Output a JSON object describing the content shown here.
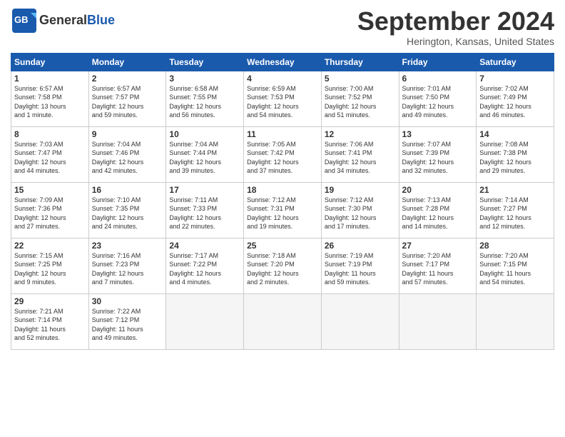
{
  "header": {
    "logo_general": "General",
    "logo_blue": "Blue",
    "title": "September 2024",
    "location": "Herington, Kansas, United States"
  },
  "calendar": {
    "days_of_week": [
      "Sunday",
      "Monday",
      "Tuesday",
      "Wednesday",
      "Thursday",
      "Friday",
      "Saturday"
    ],
    "weeks": [
      [
        {
          "day": "1",
          "info": "Sunrise: 6:57 AM\nSunset: 7:58 PM\nDaylight: 13 hours\nand 1 minute."
        },
        {
          "day": "2",
          "info": "Sunrise: 6:57 AM\nSunset: 7:57 PM\nDaylight: 12 hours\nand 59 minutes."
        },
        {
          "day": "3",
          "info": "Sunrise: 6:58 AM\nSunset: 7:55 PM\nDaylight: 12 hours\nand 56 minutes."
        },
        {
          "day": "4",
          "info": "Sunrise: 6:59 AM\nSunset: 7:53 PM\nDaylight: 12 hours\nand 54 minutes."
        },
        {
          "day": "5",
          "info": "Sunrise: 7:00 AM\nSunset: 7:52 PM\nDaylight: 12 hours\nand 51 minutes."
        },
        {
          "day": "6",
          "info": "Sunrise: 7:01 AM\nSunset: 7:50 PM\nDaylight: 12 hours\nand 49 minutes."
        },
        {
          "day": "7",
          "info": "Sunrise: 7:02 AM\nSunset: 7:49 PM\nDaylight: 12 hours\nand 46 minutes."
        }
      ],
      [
        {
          "day": "8",
          "info": "Sunrise: 7:03 AM\nSunset: 7:47 PM\nDaylight: 12 hours\nand 44 minutes."
        },
        {
          "day": "9",
          "info": "Sunrise: 7:04 AM\nSunset: 7:46 PM\nDaylight: 12 hours\nand 42 minutes."
        },
        {
          "day": "10",
          "info": "Sunrise: 7:04 AM\nSunset: 7:44 PM\nDaylight: 12 hours\nand 39 minutes."
        },
        {
          "day": "11",
          "info": "Sunrise: 7:05 AM\nSunset: 7:42 PM\nDaylight: 12 hours\nand 37 minutes."
        },
        {
          "day": "12",
          "info": "Sunrise: 7:06 AM\nSunset: 7:41 PM\nDaylight: 12 hours\nand 34 minutes."
        },
        {
          "day": "13",
          "info": "Sunrise: 7:07 AM\nSunset: 7:39 PM\nDaylight: 12 hours\nand 32 minutes."
        },
        {
          "day": "14",
          "info": "Sunrise: 7:08 AM\nSunset: 7:38 PM\nDaylight: 12 hours\nand 29 minutes."
        }
      ],
      [
        {
          "day": "15",
          "info": "Sunrise: 7:09 AM\nSunset: 7:36 PM\nDaylight: 12 hours\nand 27 minutes."
        },
        {
          "day": "16",
          "info": "Sunrise: 7:10 AM\nSunset: 7:35 PM\nDaylight: 12 hours\nand 24 minutes."
        },
        {
          "day": "17",
          "info": "Sunrise: 7:11 AM\nSunset: 7:33 PM\nDaylight: 12 hours\nand 22 minutes."
        },
        {
          "day": "18",
          "info": "Sunrise: 7:12 AM\nSunset: 7:31 PM\nDaylight: 12 hours\nand 19 minutes."
        },
        {
          "day": "19",
          "info": "Sunrise: 7:12 AM\nSunset: 7:30 PM\nDaylight: 12 hours\nand 17 minutes."
        },
        {
          "day": "20",
          "info": "Sunrise: 7:13 AM\nSunset: 7:28 PM\nDaylight: 12 hours\nand 14 minutes."
        },
        {
          "day": "21",
          "info": "Sunrise: 7:14 AM\nSunset: 7:27 PM\nDaylight: 12 hours\nand 12 minutes."
        }
      ],
      [
        {
          "day": "22",
          "info": "Sunrise: 7:15 AM\nSunset: 7:25 PM\nDaylight: 12 hours\nand 9 minutes."
        },
        {
          "day": "23",
          "info": "Sunrise: 7:16 AM\nSunset: 7:23 PM\nDaylight: 12 hours\nand 7 minutes."
        },
        {
          "day": "24",
          "info": "Sunrise: 7:17 AM\nSunset: 7:22 PM\nDaylight: 12 hours\nand 4 minutes."
        },
        {
          "day": "25",
          "info": "Sunrise: 7:18 AM\nSunset: 7:20 PM\nDaylight: 12 hours\nand 2 minutes."
        },
        {
          "day": "26",
          "info": "Sunrise: 7:19 AM\nSunset: 7:19 PM\nDaylight: 11 hours\nand 59 minutes."
        },
        {
          "day": "27",
          "info": "Sunrise: 7:20 AM\nSunset: 7:17 PM\nDaylight: 11 hours\nand 57 minutes."
        },
        {
          "day": "28",
          "info": "Sunrise: 7:20 AM\nSunset: 7:15 PM\nDaylight: 11 hours\nand 54 minutes."
        }
      ],
      [
        {
          "day": "29",
          "info": "Sunrise: 7:21 AM\nSunset: 7:14 PM\nDaylight: 11 hours\nand 52 minutes."
        },
        {
          "day": "30",
          "info": "Sunrise: 7:22 AM\nSunset: 7:12 PM\nDaylight: 11 hours\nand 49 minutes."
        },
        {
          "day": "",
          "info": ""
        },
        {
          "day": "",
          "info": ""
        },
        {
          "day": "",
          "info": ""
        },
        {
          "day": "",
          "info": ""
        },
        {
          "day": "",
          "info": ""
        }
      ]
    ]
  }
}
